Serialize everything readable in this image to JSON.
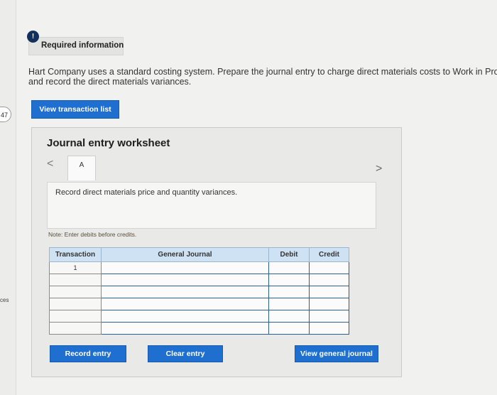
{
  "sidebar": {
    "badge": "47",
    "label": "ces"
  },
  "required": {
    "icon": "!",
    "label": "Required information"
  },
  "intro": {
    "line1": "Hart Company uses a standard costing system. Prepare the journal entry to charge direct materials costs to Work in Proc",
    "line2": "and record the direct materials variances."
  },
  "buttons": {
    "view_transaction": "View transaction list",
    "record": "Record entry",
    "clear": "Clear entry",
    "view_journal": "View general journal"
  },
  "worksheet": {
    "title": "Journal entry worksheet",
    "prev": "<",
    "next": ">",
    "tab": "A",
    "description": "Record direct materials price and quantity variances.",
    "note": "Note: Enter debits before credits."
  },
  "table": {
    "headers": [
      "Transaction",
      "General Journal",
      "Debit",
      "Credit"
    ],
    "rows": [
      {
        "transaction": "1",
        "account": "",
        "debit": "",
        "credit": ""
      },
      {
        "transaction": "",
        "account": "",
        "debit": "",
        "credit": ""
      },
      {
        "transaction": "",
        "account": "",
        "debit": "",
        "credit": ""
      },
      {
        "transaction": "",
        "account": "",
        "debit": "",
        "credit": ""
      },
      {
        "transaction": "",
        "account": "",
        "debit": "",
        "credit": ""
      },
      {
        "transaction": "",
        "account": "",
        "debit": "",
        "credit": ""
      }
    ]
  }
}
